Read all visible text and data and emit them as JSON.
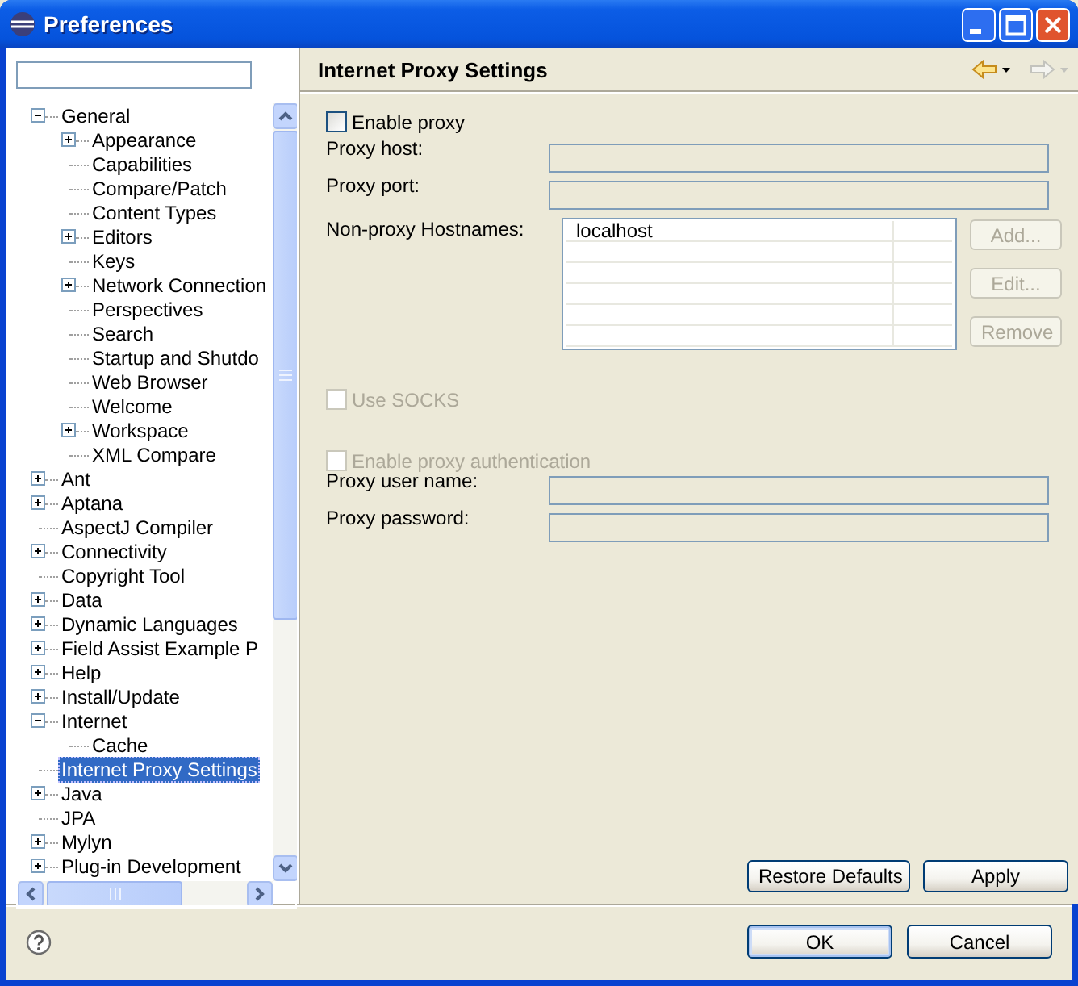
{
  "window": {
    "title": "Preferences"
  },
  "tree": [
    {
      "label": "General",
      "kind": "branch",
      "expanded": true,
      "selected": false,
      "children": [
        {
          "label": "Appearance",
          "kind": "branch",
          "expanded": false,
          "selected": false
        },
        {
          "label": "Capabilities",
          "kind": "leaf",
          "selected": false
        },
        {
          "label": "Compare/Patch",
          "kind": "leaf",
          "selected": false
        },
        {
          "label": "Content Types",
          "kind": "leaf",
          "selected": false
        },
        {
          "label": "Editors",
          "kind": "branch",
          "expanded": false,
          "selected": false
        },
        {
          "label": "Keys",
          "kind": "leaf",
          "selected": false
        },
        {
          "label": "Network Connection",
          "kind": "branch",
          "expanded": false,
          "selected": false
        },
        {
          "label": "Perspectives",
          "kind": "leaf",
          "selected": false
        },
        {
          "label": "Search",
          "kind": "leaf",
          "selected": false
        },
        {
          "label": "Startup and Shutdo",
          "kind": "leaf",
          "selected": false
        },
        {
          "label": "Web Browser",
          "kind": "leaf",
          "selected": false
        },
        {
          "label": "Welcome",
          "kind": "leaf",
          "selected": false
        },
        {
          "label": "Workspace",
          "kind": "branch",
          "expanded": false,
          "selected": false
        },
        {
          "label": "XML Compare",
          "kind": "leaf",
          "selected": false
        }
      ]
    },
    {
      "label": "Ant",
      "kind": "branch",
      "expanded": false,
      "selected": false
    },
    {
      "label": "Aptana",
      "kind": "branch",
      "expanded": false,
      "selected": false
    },
    {
      "label": "AspectJ Compiler",
      "kind": "leaf",
      "selected": false
    },
    {
      "label": "Connectivity",
      "kind": "branch",
      "expanded": false,
      "selected": false
    },
    {
      "label": "Copyright Tool",
      "kind": "leaf",
      "selected": false
    },
    {
      "label": "Data",
      "kind": "branch",
      "expanded": false,
      "selected": false
    },
    {
      "label": "Dynamic Languages",
      "kind": "branch",
      "expanded": false,
      "selected": false
    },
    {
      "label": "Field Assist Example P",
      "kind": "branch",
      "expanded": false,
      "selected": false
    },
    {
      "label": "Help",
      "kind": "branch",
      "expanded": false,
      "selected": false
    },
    {
      "label": "Install/Update",
      "kind": "branch",
      "expanded": false,
      "selected": false
    },
    {
      "label": "Internet",
      "kind": "branch",
      "expanded": true,
      "selected": false,
      "children": [
        {
          "label": "Cache",
          "kind": "leaf",
          "selected": false
        }
      ]
    },
    {
      "label": "Internet Proxy Settings",
      "kind": "leaf",
      "selected": true
    },
    {
      "label": "Java",
      "kind": "branch",
      "expanded": false,
      "selected": false
    },
    {
      "label": "JPA",
      "kind": "leaf",
      "selected": false
    },
    {
      "label": "Mylyn",
      "kind": "branch",
      "expanded": false,
      "selected": false
    },
    {
      "label": "Plug-in Development",
      "kind": "branch",
      "expanded": false,
      "selected": false
    }
  ],
  "page": {
    "title": "Internet Proxy Settings",
    "enable_proxy": {
      "label": "Enable proxy",
      "checked": false,
      "disabled": false
    },
    "proxy_fields": [
      {
        "label": "Proxy host:",
        "disabled": true
      },
      {
        "label": "Proxy port:",
        "disabled": true
      }
    ],
    "non_proxy_hosts": {
      "label": "Non-proxy Hostnames:",
      "rows": [
        {
          "host": "localhost"
        }
      ],
      "buttons": [
        {
          "label": "Add...",
          "disabled": true
        },
        {
          "label": "Edit...",
          "disabled": true
        },
        {
          "label": "Remove",
          "disabled": true
        }
      ]
    },
    "use_socks": {
      "label": "Use SOCKS",
      "checked": false,
      "disabled": true
    },
    "enable_auth": {
      "label": "Enable proxy authentication",
      "checked": false,
      "disabled": true
    },
    "auth_fields": [
      {
        "label": "Proxy user name:",
        "disabled": true
      },
      {
        "label": "Proxy password:",
        "disabled": true
      }
    ],
    "buttons": [
      {
        "label": "Restore Defaults"
      },
      {
        "label": "Apply"
      }
    ]
  },
  "dialog_buttons": [
    {
      "label": "OK",
      "default": true
    },
    {
      "label": "Cancel",
      "default": false
    }
  ]
}
